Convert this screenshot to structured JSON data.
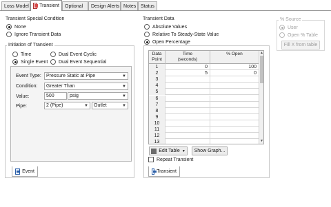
{
  "tabs": [
    {
      "label": "Loss Model",
      "active": false
    },
    {
      "label": "Transient",
      "active": true
    },
    {
      "label": "Optional",
      "active": false
    },
    {
      "label": "Design Alerts",
      "active": false
    },
    {
      "label": "Notes",
      "active": false
    },
    {
      "label": "Status",
      "active": false
    }
  ],
  "special_condition": {
    "title": "Transient Special Condition",
    "options": [
      {
        "label": "None",
        "selected": true
      },
      {
        "label": "Ignore Transient Data",
        "selected": false
      }
    ]
  },
  "initiation": {
    "title": "Initiation of Transient",
    "options": [
      {
        "label": "Time",
        "selected": false
      },
      {
        "label": "Dual Event Cyclic",
        "selected": false
      },
      {
        "label": "Single Event",
        "selected": true
      },
      {
        "label": "Dual Event Sequential",
        "selected": false
      }
    ],
    "event": {
      "event_type_label": "Event Type:",
      "event_type_value": "Pressure Static at Pipe",
      "condition_label": "Condition:",
      "condition_value": "Greater Than",
      "value_label": "Value:",
      "value_value": "500",
      "value_unit": "psig",
      "pipe_label": "Pipe:",
      "pipe_value": "2 (Pipe)",
      "pipe_end": "Outlet"
    },
    "footer_tab": "Event"
  },
  "transient_data": {
    "title": "Transient Data",
    "options": [
      {
        "label": "Absolute Values",
        "selected": false
      },
      {
        "label": "Relative To Steady-State Value",
        "selected": false
      },
      {
        "label": "Open Percentage",
        "selected": true
      }
    ],
    "table": {
      "headers": [
        "Data\nPoint",
        "Time\n(seconds)",
        "% Open"
      ],
      "rows": [
        {
          "point": "1",
          "time": "0",
          "open": "100"
        },
        {
          "point": "2",
          "time": "5",
          "open": "0"
        },
        {
          "point": "3",
          "time": "",
          "open": ""
        },
        {
          "point": "4",
          "time": "",
          "open": ""
        },
        {
          "point": "5",
          "time": "",
          "open": ""
        },
        {
          "point": "6",
          "time": "",
          "open": ""
        },
        {
          "point": "7",
          "time": "",
          "open": ""
        },
        {
          "point": "8",
          "time": "",
          "open": ""
        },
        {
          "point": "9",
          "time": "",
          "open": ""
        },
        {
          "point": "10",
          "time": "",
          "open": ""
        },
        {
          "point": "11",
          "time": "",
          "open": ""
        },
        {
          "point": "12",
          "time": "",
          "open": ""
        },
        {
          "point": "13",
          "time": "",
          "open": ""
        }
      ]
    },
    "edit_table_label": "Edit Table",
    "show_graph_label": "Show Graph...",
    "repeat_label": "Repeat Transient",
    "footer_tab": "Transient"
  },
  "source": {
    "title": "% Source",
    "options": [
      {
        "label": "User",
        "selected": true
      },
      {
        "label": "Open % Table",
        "selected": false
      }
    ],
    "fill_button": "Fill X from table"
  },
  "icons": {
    "tab_icon": "transient-tab-icon",
    "event_icon": "event-icon",
    "transient_icon": "transient-icon"
  }
}
